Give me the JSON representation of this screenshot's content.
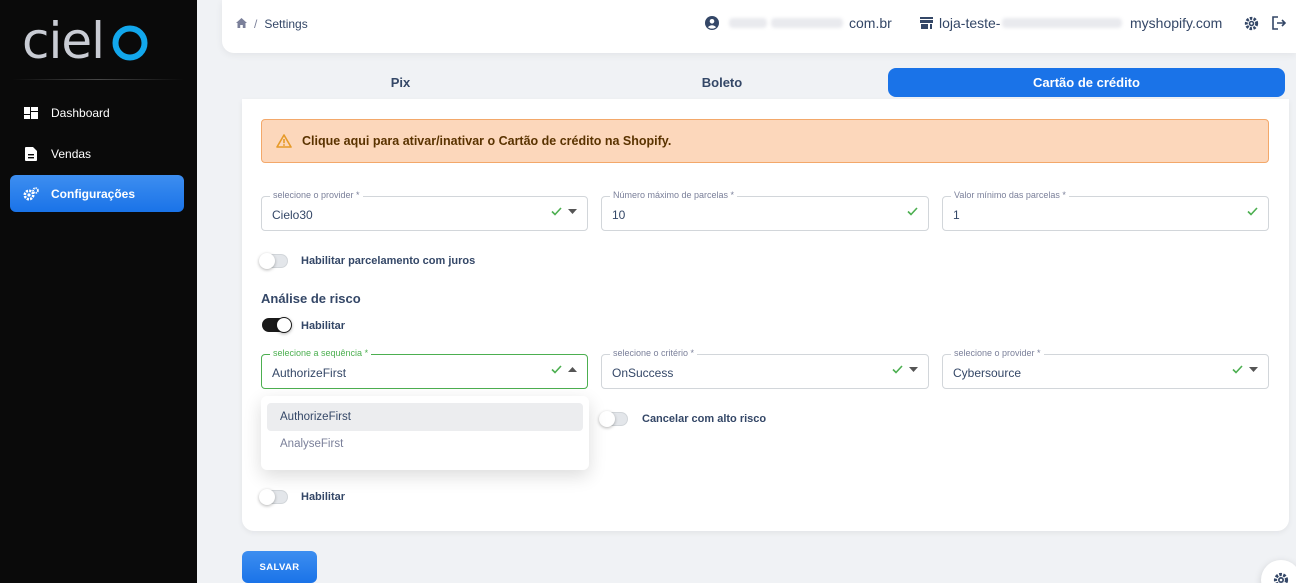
{
  "sidebar": {
    "logo_text": "cielo",
    "items": [
      {
        "label": "Dashboard",
        "icon": "dashboard-icon"
      },
      {
        "label": "Vendas",
        "icon": "document-icon"
      },
      {
        "label": "Configurações",
        "icon": "gear-icon",
        "active": true
      }
    ]
  },
  "header": {
    "breadcrumb": {
      "sep": "/",
      "current": "Settings"
    },
    "user_email_visible": "com.br",
    "store_prefix": "loja-teste-",
    "store_suffix": "myshopify.com"
  },
  "tabs": [
    {
      "label": "Pix"
    },
    {
      "label": "Boleto"
    },
    {
      "label": "Cartão de crédito",
      "active": true
    }
  ],
  "card": {
    "alert_text": "Clique aqui para ativar/inativar o Cartão de crédito na Shopify.",
    "provider_field": {
      "label": "selecione o provider *",
      "value": "Cielo30"
    },
    "installments_field": {
      "label": "Número máximo de parcelas *",
      "value": "10"
    },
    "min_value_field": {
      "label": "Valor mínimo das parcelas *",
      "value": "1"
    },
    "interest_toggle": {
      "label": "Habilitar parcelamento com juros",
      "on": false
    },
    "risk_title": "Análise de risco",
    "risk_toggle": {
      "label": "Habilitar",
      "on": true
    },
    "sequence_field": {
      "label": "selecione a sequência *",
      "value": "AuthorizeFirst"
    },
    "criteria_field": {
      "label": "selecione o critério *",
      "value": "OnSuccess"
    },
    "risk_provider_field": {
      "label": "selecione o provider *",
      "value": "Cybersource"
    },
    "cancel_toggle": {
      "label": "Cancelar com alto risco",
      "on": false
    },
    "bottom_toggle": {
      "label": "Habilitar",
      "on": false
    },
    "sequence_options": [
      "AuthorizeFirst",
      "AnalyseFirst"
    ]
  },
  "save_label": "SALVAR",
  "colors": {
    "primary": "#1a73e8",
    "success": "#4caf50",
    "alert_bg": "#fcd7bb",
    "sidebar_bg": "#0a0a0a"
  }
}
